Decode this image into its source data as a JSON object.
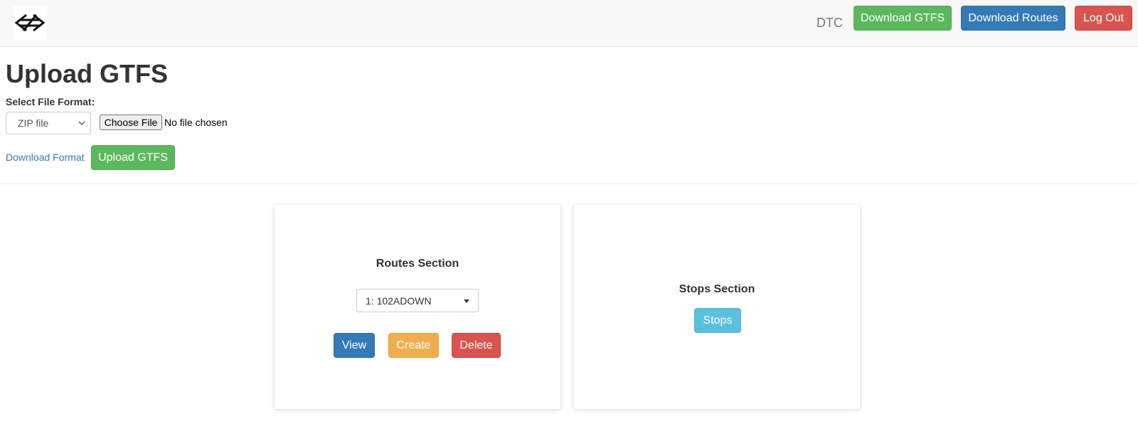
{
  "navbar": {
    "logo_icon": "arrows-logo-icon",
    "user": "DTC",
    "download_gtfs_label": "Download GTFS",
    "download_routes_label": "Download Routes",
    "logout_label": "Log Out"
  },
  "upload": {
    "title": "Upload GTFS",
    "format_label": "Select File Format:",
    "format_value": "ZIP file",
    "choose_file_label": "Choose File",
    "file_status": "No file chosen",
    "download_format_link": "Download Format",
    "upload_button": "Upload GTFS"
  },
  "routes_card": {
    "title": "Routes Section",
    "selected_route": "1: 102ADOWN",
    "view_label": "View",
    "create_label": "Create",
    "delete_label": "Delete"
  },
  "stops_card": {
    "title": "Stops Section",
    "stops_label": "Stops"
  },
  "colors": {
    "success": "#5cb85c",
    "primary": "#337ab7",
    "danger": "#d9534f",
    "warning": "#f0ad4e",
    "info": "#5bc0de"
  }
}
